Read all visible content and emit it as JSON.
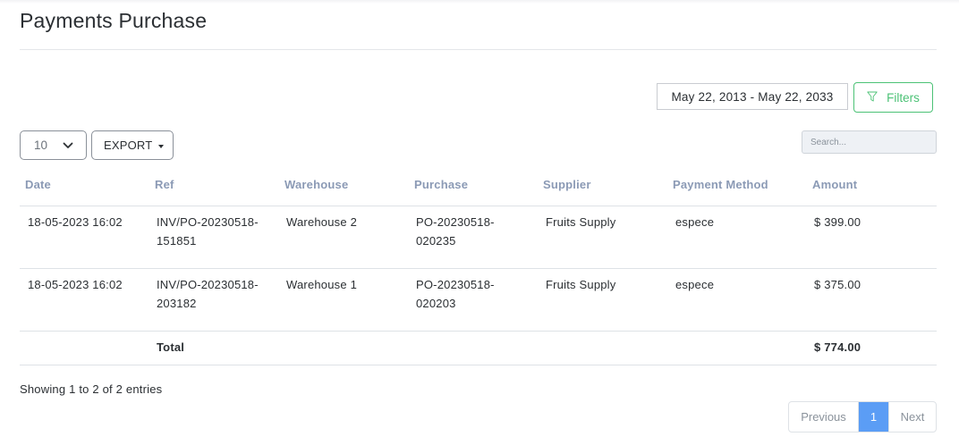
{
  "page": {
    "title": "Payments Purchase"
  },
  "toolbar": {
    "date_range": "May 22, 2013 - May 22, 2033",
    "filters_label": "Filters",
    "per_page": "10",
    "export_label": "EXPORT",
    "search_placeholder": "Search..."
  },
  "table": {
    "columns": [
      "Date",
      "Ref",
      "Warehouse",
      "Purchase",
      "Supplier",
      "Payment Method",
      "Amount"
    ],
    "rows": [
      {
        "date": "18-05-2023 16:02",
        "ref_line1": "INV/PO-20230518-",
        "ref_line2": "151851",
        "warehouse": "Warehouse 2",
        "purchase_line1": "PO-20230518-",
        "purchase_line2": "020235",
        "supplier": "Fruits Supply",
        "payment_method": "espece",
        "amount": "$ 399.00"
      },
      {
        "date": "18-05-2023 16:02",
        "ref_line1": "INV/PO-20230518-",
        "ref_line2": "203182",
        "warehouse": "Warehouse 1",
        "purchase_line1": "PO-20230518-",
        "purchase_line2": "020203",
        "supplier": "Fruits Supply",
        "payment_method": "espece",
        "amount": "$ 375.00"
      }
    ],
    "total_label": "Total",
    "total_amount": "$ 774.00"
  },
  "footer": {
    "info": "Showing 1 to 2 of 2 entries",
    "prev_label": "Previous",
    "current_page": "1",
    "next_label": "Next"
  },
  "colors": {
    "accent_green": "#4cc276",
    "pager_active": "#5b9df5",
    "header_text": "#8b9ab5"
  }
}
